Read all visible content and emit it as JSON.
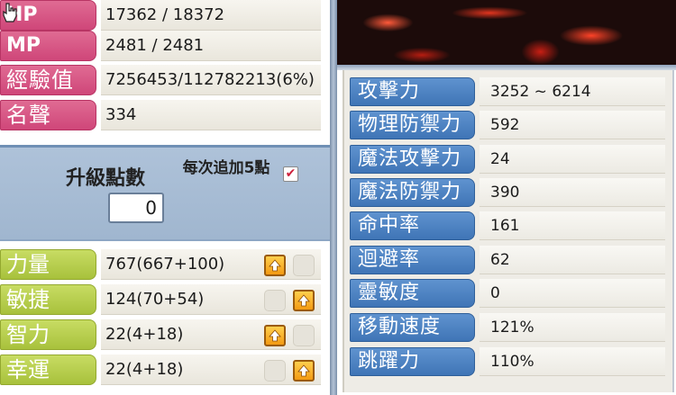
{
  "vitals": [
    {
      "label": "HP",
      "value": "17362 / 18372"
    },
    {
      "label": "MP",
      "value": "2481 / 2481"
    },
    {
      "label": "經驗值",
      "value": "7256453/112782213(6%)"
    },
    {
      "label": "名聲",
      "value": "334"
    }
  ],
  "bonus": {
    "title": "升級點數",
    "points": "0",
    "plus5_label": "每次追加5點",
    "plus5_checked": true,
    "check_mark": "✔"
  },
  "stats": [
    {
      "label": "力量",
      "value": "767(667+100)",
      "button_slot": 1
    },
    {
      "label": "敏捷",
      "value": "124(70+54)",
      "button_slot": 2
    },
    {
      "label": "智力",
      "value": "22(4+18)",
      "button_slot": 1
    },
    {
      "label": "幸運",
      "value": "22(4+18)",
      "button_slot": 2
    }
  ],
  "combat": [
    {
      "label": "攻擊力",
      "value": "3252 ~ 6214"
    },
    {
      "label": "物理防禦力",
      "value": "592"
    },
    {
      "label": "魔法攻擊力",
      "value": "24"
    },
    {
      "label": "魔法防禦力",
      "value": "390"
    },
    {
      "label": "命中率",
      "value": "161"
    },
    {
      "label": "迴避率",
      "value": "62"
    },
    {
      "label": "靈敏度",
      "value": "0"
    },
    {
      "label": "移動速度",
      "value": "121%"
    },
    {
      "label": "跳躍力",
      "value": "110%"
    }
  ],
  "icons": {
    "stat_up_button": "arrow-up-icon",
    "cursor": "hand-cursor-icon"
  },
  "colors": {
    "vital_label": "#d9557f",
    "stat_label": "#b8cf4b",
    "combat_label": "#4f86c6",
    "up_button": "#f7ab24",
    "panel_blue": "#a9bdd5"
  }
}
